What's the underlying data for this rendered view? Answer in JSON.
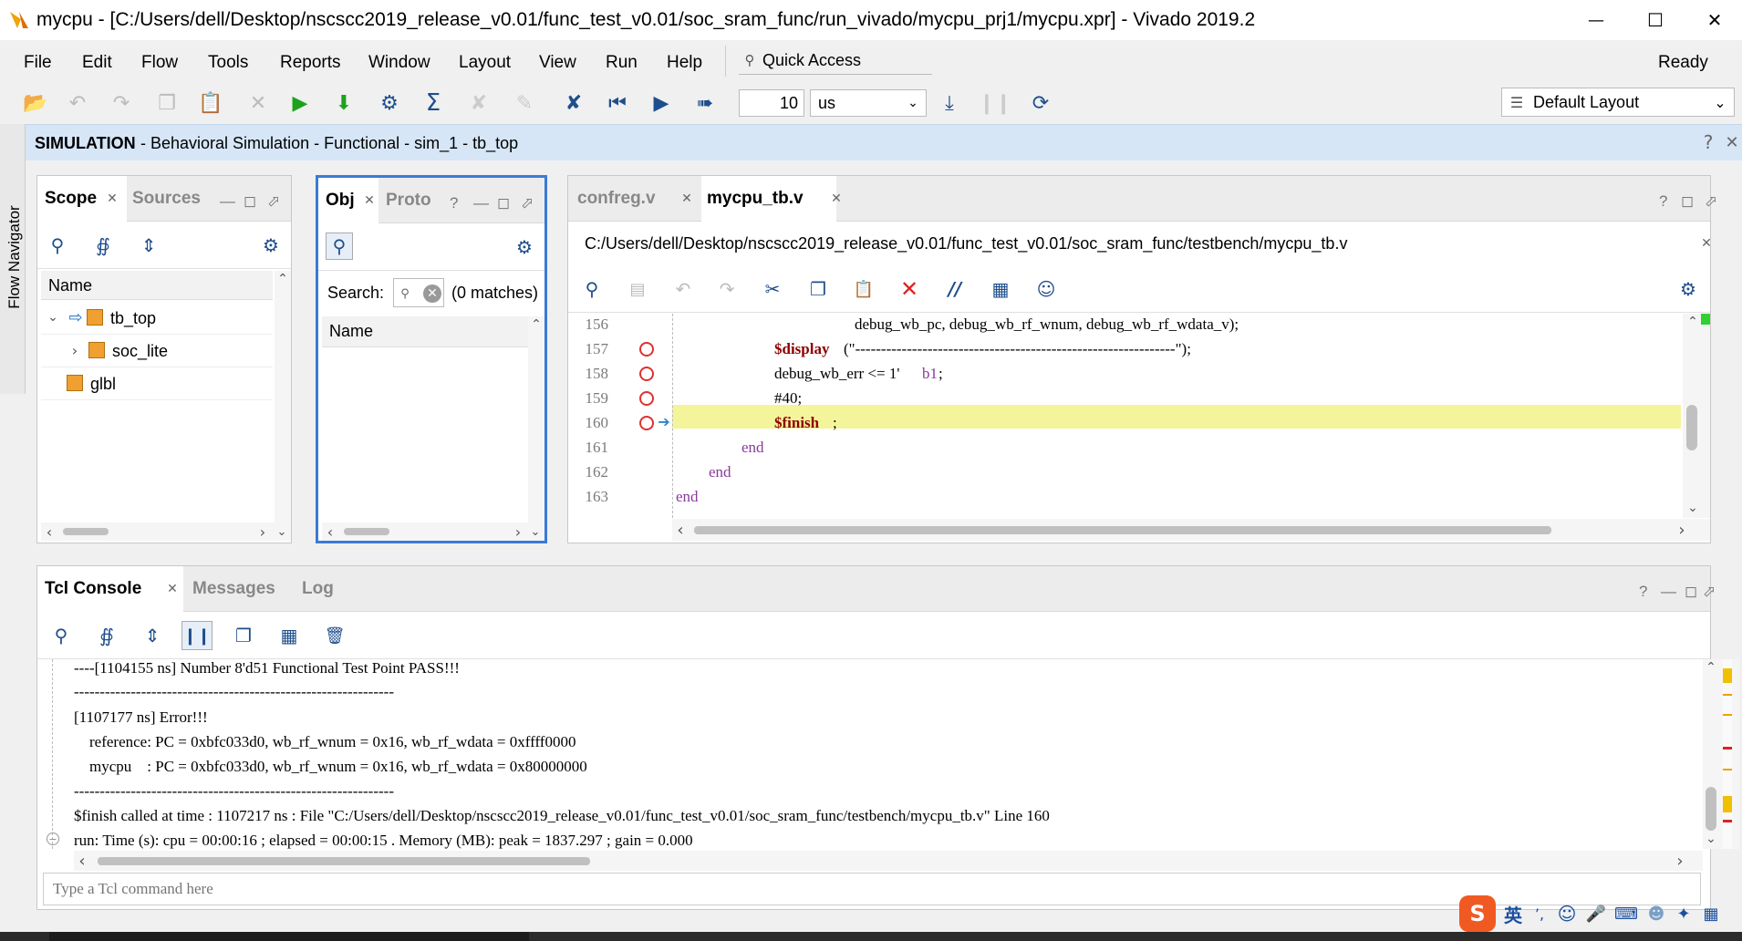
{
  "window": {
    "title": "mycpu - [C:/Users/dell/Desktop/nscscc2019_release_v0.01/func_test_v0.01/soc_sram_func/run_vivado/mycpu_prj1/mycpu.xpr] - Vivado 2019.2",
    "minimize": "—",
    "maximize": "☐",
    "close": "✕"
  },
  "menu": {
    "items": [
      "File",
      "Edit",
      "Flow",
      "Tools",
      "Reports",
      "Window",
      "Layout",
      "View",
      "Run",
      "Help"
    ],
    "quick_access": "Quick Access",
    "status": "Ready"
  },
  "toolbar": {
    "run_time_value": "10",
    "run_time_unit": "us",
    "layout": "Default Layout"
  },
  "simulation_bar": {
    "label": "SIMULATION",
    "detail": " - Behavioral Simulation - Functional - sim_1 - tb_top",
    "help": "?",
    "close": "✕"
  },
  "flow_navigator": {
    "label": "Flow Navigator"
  },
  "scope_panel": {
    "tabs": [
      "Scope",
      "Sources"
    ],
    "column": "Name",
    "tree": [
      "tb_top",
      "soc_lite",
      "glbl"
    ]
  },
  "objects_panel": {
    "tabs": [
      "Obj",
      "Proto"
    ],
    "search_label": "Search:",
    "matches": "(0 matches)",
    "column": "Name"
  },
  "editor": {
    "tabs": [
      "confreg.v",
      "mycpu_tb.v"
    ],
    "path": "C:/Users/dell/Desktop/nscscc2019_release_v0.01/func_test_v0.01/soc_sram_func/testbench/mycpu_tb.v",
    "lines": [
      {
        "num": "156",
        "text": "debug_wb_pc, debug_wb_rf_wnum, debug_wb_rf_wdata_v);"
      },
      {
        "num": "157",
        "kw": "$display",
        "text": "(\"--------------------------------------------------------------\");"
      },
      {
        "num": "158",
        "text": "debug_wb_err <= 1'",
        "lit": "b1",
        "tail": ";"
      },
      {
        "num": "159",
        "text": "#40;"
      },
      {
        "num": "160",
        "kw": "$finish",
        "text": ";"
      },
      {
        "num": "161",
        "kwp": "end"
      },
      {
        "num": "162",
        "kwp": "end"
      },
      {
        "num": "163",
        "kwp": "end"
      }
    ]
  },
  "console": {
    "tabs": [
      "Tcl Console",
      "Messages",
      "Log"
    ],
    "lines": [
      "----[1104155 ns] Number 8'd51 Functional Test Point PASS!!!",
      "--------------------------------------------------------------",
      "[1107177 ns] Error!!!",
      "    reference: PC = 0xbfc033d0, wb_rf_wnum = 0x16, wb_rf_wdata = 0xffff0000",
      "    mycpu    : PC = 0xbfc033d0, wb_rf_wnum = 0x16, wb_rf_wdata = 0x80000000",
      "--------------------------------------------------------------",
      "$finish called at time : 1107217 ns : File \"C:/Users/dell/Desktop/nscscc2019_release_v0.01/func_test_v0.01/soc_sram_func/testbench/mycpu_tb.v\" Line 160",
      "run: Time (s): cpu = 00:00:16 ; elapsed = 00:00:15 . Memory (MB): peak = 1837.297 ; gain = 0.000"
    ],
    "input_placeholder": "Type a Tcl command here"
  },
  "ime": {
    "lang": "英"
  },
  "colors": {
    "accent_blue": "#3a7bd5",
    "highlight_line": "#f4f49a",
    "breakpoint_red": "#e03030",
    "keyword": "#8b0000"
  }
}
